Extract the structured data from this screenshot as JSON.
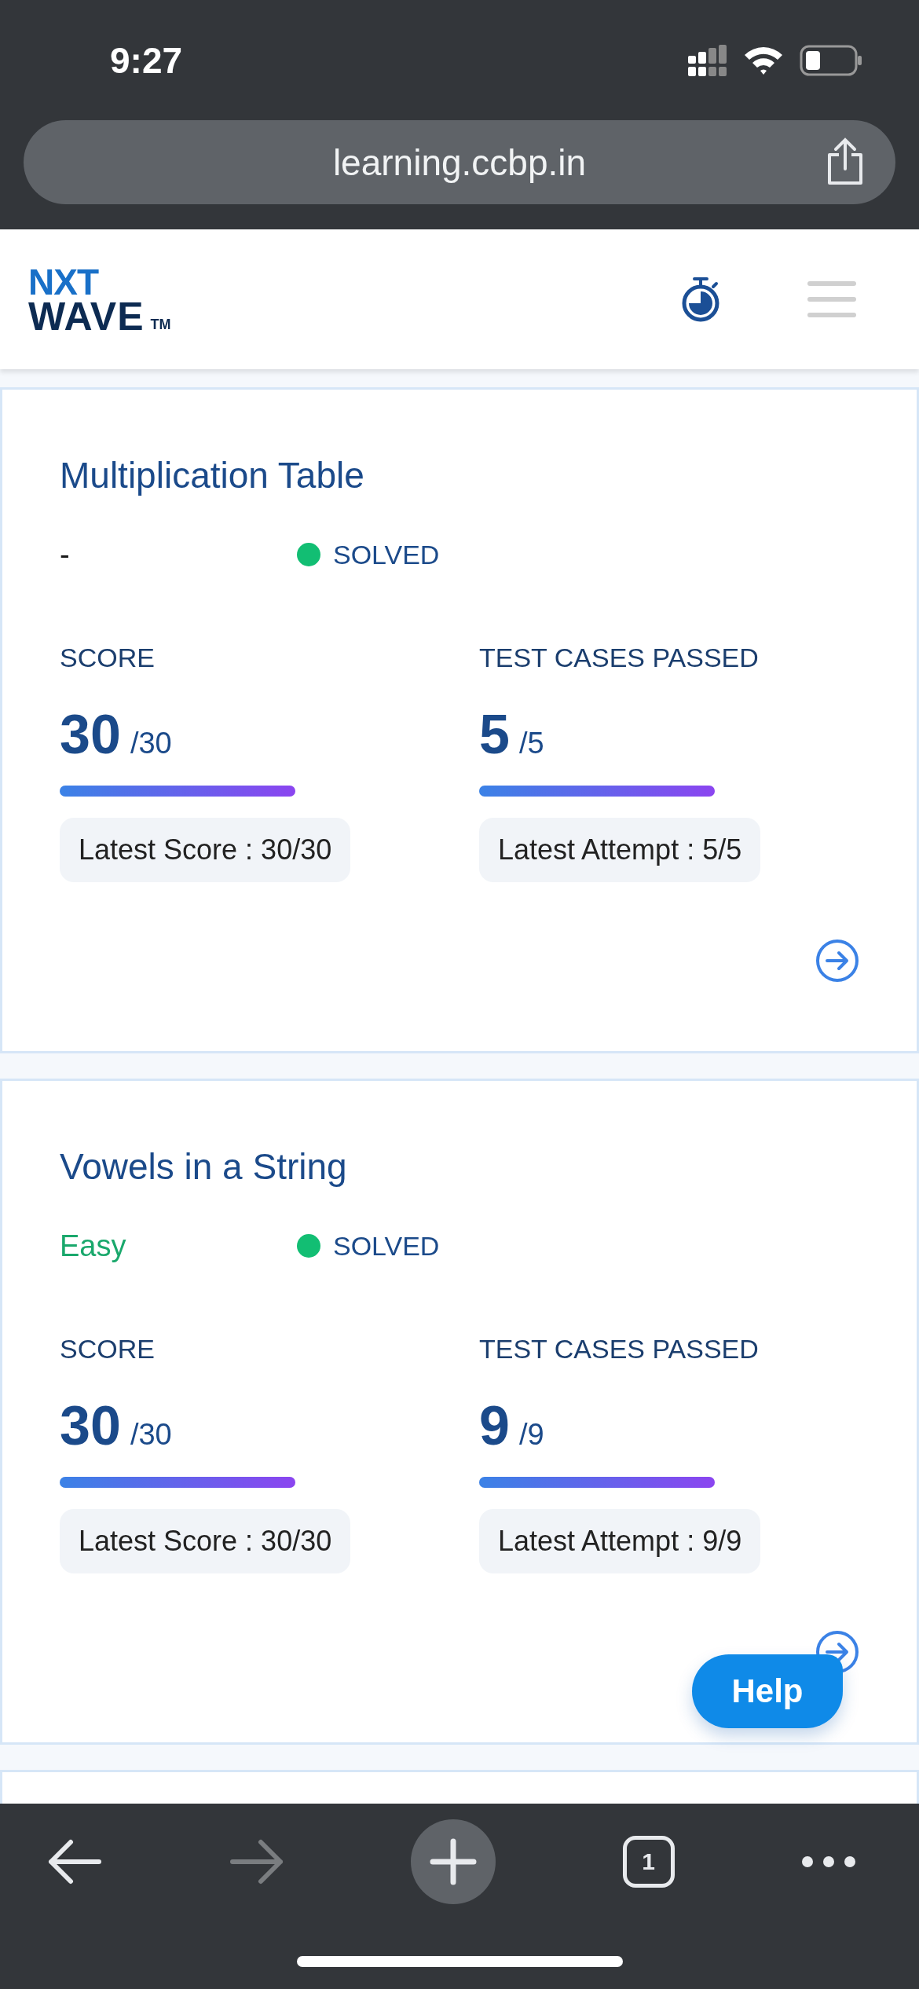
{
  "status_bar": {
    "time": "9:27"
  },
  "browser": {
    "url": "learning.ccbp.in",
    "tab_count": "1"
  },
  "header": {
    "logo_top": "NXT",
    "logo_bottom": "WAVE",
    "logo_mark": "TM"
  },
  "problems": [
    {
      "title": "Multiplication Table",
      "difficulty": {
        "text": "-",
        "kind": "none"
      },
      "status": "SOLVED",
      "score": {
        "label": "SCORE",
        "value": "30",
        "total": "/30",
        "level": 1,
        "latest": "Latest Score : 30/30"
      },
      "tests": {
        "label": "TEST CASES PASSED",
        "value": "5",
        "total": "/5",
        "level": 1,
        "latest": "Latest Attempt : 5/5"
      }
    },
    {
      "title": "Vowels in a String",
      "difficulty": {
        "text": "Easy",
        "kind": "easy"
      },
      "status": "SOLVED",
      "score": {
        "label": "SCORE",
        "value": "30",
        "total": "/30",
        "level": 1,
        "latest": "Latest Score : 30/30"
      },
      "tests": {
        "label": "TEST CASES PASSED",
        "value": "9",
        "total": "/9",
        "level": 1,
        "latest": "Latest Attempt : 9/9"
      }
    }
  ],
  "help_button": {
    "label": "Help"
  }
}
